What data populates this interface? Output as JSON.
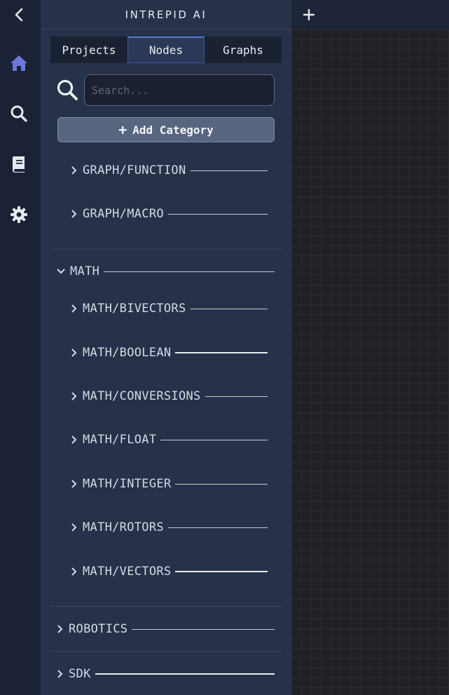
{
  "app": {
    "title": "INTREPID AI"
  },
  "rail": {
    "items": [
      {
        "icon": "chevron-left-icon",
        "color": "#e6e9ef"
      },
      {
        "icon": "home-icon",
        "color": "#6b78d8",
        "active": true
      },
      {
        "icon": "search-icon",
        "color": "#e6e9ef"
      },
      {
        "icon": "book-icon",
        "color": "#e6e9ef"
      },
      {
        "icon": "gear-icon",
        "color": "#e6e9ef"
      }
    ]
  },
  "tabs": [
    {
      "label": "Projects",
      "active": false
    },
    {
      "label": "Nodes",
      "active": true
    },
    {
      "label": "Graphs",
      "active": false
    }
  ],
  "search": {
    "placeholder": "Search...",
    "value": ""
  },
  "add_category": {
    "label": "Add Category",
    "icon": "plus-icon"
  },
  "tree": {
    "graph_children": [
      {
        "label": "GRAPH/FUNCTION"
      },
      {
        "label": "GRAPH/MACRO"
      }
    ],
    "math": {
      "label": "MATH",
      "expanded": true,
      "children": [
        {
          "label": "MATH/BIVECTORS"
        },
        {
          "label": "MATH/BOOLEAN"
        },
        {
          "label": "MATH/CONVERSIONS"
        },
        {
          "label": "MATH/FLOAT"
        },
        {
          "label": "MATH/INTEGER"
        },
        {
          "label": "MATH/ROTORS"
        },
        {
          "label": "MATH/VECTORS"
        }
      ]
    },
    "robotics": {
      "label": "ROBOTICS",
      "expanded": false
    },
    "sdk": {
      "label": "SDK",
      "expanded": false
    }
  },
  "canvas": {
    "new_graph_icon": "plus-icon"
  },
  "colors": {
    "accent": "#6b78d8",
    "panel": "#27324a",
    "rail": "#1b2236",
    "canvas": "#202126"
  }
}
